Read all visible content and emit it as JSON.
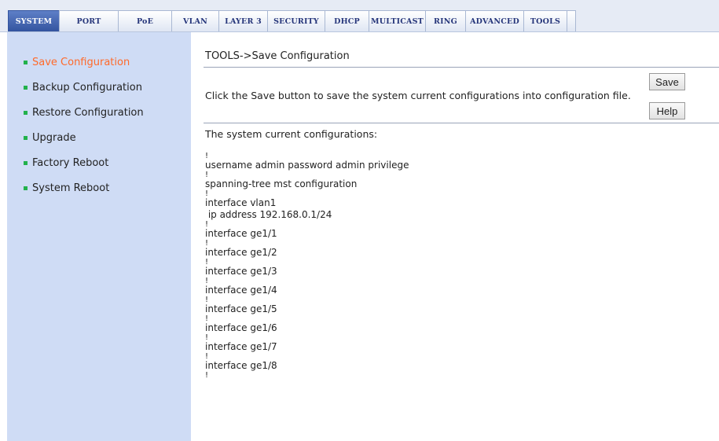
{
  "tabs": [
    "SYSTEM",
    "PORT",
    "PoE",
    "VLAN",
    "LAYER 3",
    "SECURITY",
    "DHCP",
    "MULTICAST",
    "RING",
    "ADVANCED",
    "TOOLS"
  ],
  "active_tab": "SYSTEM",
  "sidebar": {
    "items": [
      {
        "label": "Save Configuration",
        "active": true
      },
      {
        "label": "Backup Configuration"
      },
      {
        "label": "Restore Configuration"
      },
      {
        "label": "Upgrade"
      },
      {
        "label": "Factory Reboot"
      },
      {
        "label": "System Reboot"
      }
    ]
  },
  "main": {
    "breadcrumb": "TOOLS->Save Configuration",
    "description": "Click the Save button to save the system current configurations into configuration file.",
    "save_label": "Save",
    "help_label": "Help",
    "config_title": "The system current configurations:",
    "config_lines": [
      "!",
      "username admin password admin privilege",
      "!",
      "spanning-tree mst configuration",
      "!",
      "interface vlan1",
      " ip address 192.168.0.1/24",
      "!",
      "interface ge1/1",
      "!",
      "interface ge1/2",
      "!",
      "interface ge1/3",
      "!",
      "interface ge1/4",
      "!",
      "interface ge1/5",
      "!",
      "interface ge1/6",
      "!",
      "interface ge1/7",
      "!",
      "interface ge1/8",
      "!"
    ]
  },
  "colors": {
    "sidebar_bg": "#cfdcf5",
    "active_item": "#ff6a2a",
    "bullet": "#22b14c",
    "active_tab_bg": "#33549f"
  }
}
